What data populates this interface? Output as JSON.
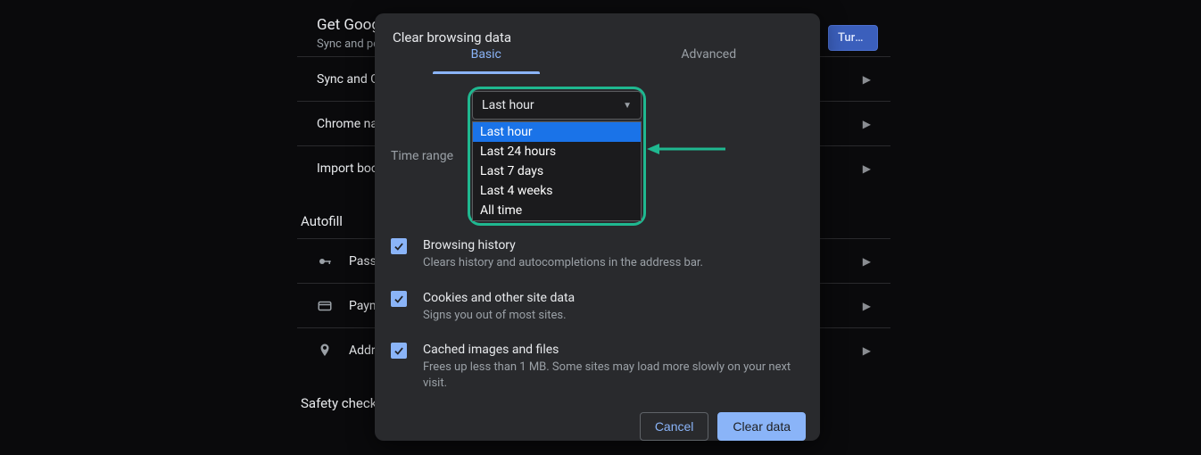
{
  "background": {
    "header_title": "Get Google smarts in Chrome",
    "header_sub": "Sync and personalize Chrome across your devices",
    "turn_on": "Turn on sync…",
    "rows1": [
      "Sync and Google services",
      "Chrome name and picture",
      "Import bookmarks and settings"
    ],
    "section_autofill": "Autofill",
    "autofill_rows": [
      "Passwords",
      "Payment methods",
      "Addresses and more"
    ],
    "section_safety": "Safety check"
  },
  "modal": {
    "title": "Clear browsing data",
    "tabs": {
      "basic": "Basic",
      "advanced": "Advanced"
    },
    "time_range_label": "Time range",
    "select_value": "Last hour",
    "options": [
      "Last hour",
      "Last 24 hours",
      "Last 7 days",
      "Last 4 weeks",
      "All time"
    ],
    "items": [
      {
        "title": "Browsing history",
        "sub": "Clears history and autocompletions in the address bar."
      },
      {
        "title": "Cookies and other site data",
        "sub": "Signs you out of most sites."
      },
      {
        "title": "Cached images and files",
        "sub": "Frees up less than 1 MB. Some sites may load more slowly on your next visit."
      }
    ],
    "cancel": "Cancel",
    "clear": "Clear data"
  }
}
